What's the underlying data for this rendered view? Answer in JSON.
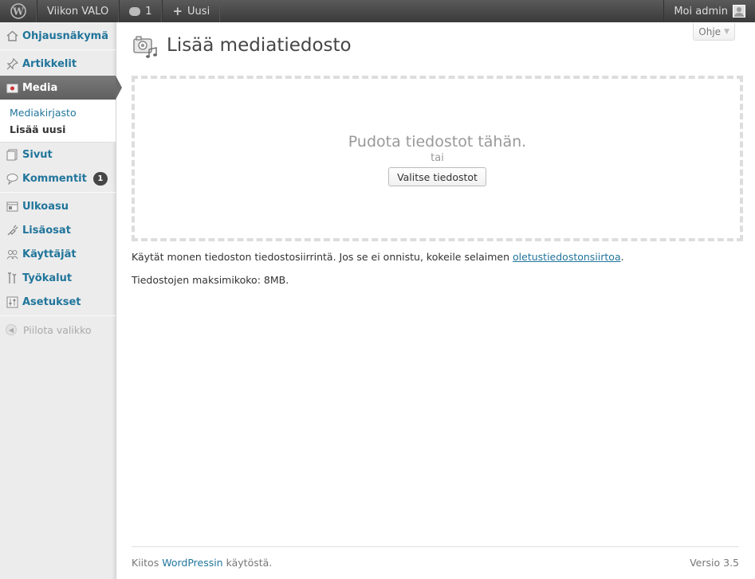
{
  "adminbar": {
    "logo_icon": "wordpress-logo-icon",
    "site_name": "Viikon VALO",
    "comments_count": "1",
    "new_label": "Uusi",
    "greeting": "Moi admin"
  },
  "sidebar": {
    "items": [
      {
        "label": "Ohjausnäkymä",
        "icon": "dashboard-icon"
      },
      {
        "label": "Artikkelit",
        "icon": "pin-icon"
      },
      {
        "label": "Media",
        "icon": "media-icon"
      },
      {
        "label": "Sivut",
        "icon": "pages-icon"
      },
      {
        "label": "Kommentit",
        "icon": "comments-icon",
        "badge": "1"
      },
      {
        "label": "Ulkoasu",
        "icon": "appearance-icon"
      },
      {
        "label": "Lisäosat",
        "icon": "plugins-icon"
      },
      {
        "label": "Käyttäjät",
        "icon": "users-icon"
      },
      {
        "label": "Työkalut",
        "icon": "tools-icon"
      },
      {
        "label": "Asetukset",
        "icon": "settings-icon"
      }
    ],
    "media_submenu": [
      {
        "label": "Mediakirjasto"
      },
      {
        "label": "Lisää uusi"
      }
    ],
    "collapse_label": "Piilota valikko"
  },
  "help": {
    "label": "Ohje"
  },
  "page": {
    "title": "Lisää mediatiedosto",
    "drop_text": "Pudota tiedostot tähän.",
    "or_text": "tai",
    "select_button": "Valitse tiedostot",
    "uploader_info_prefix": "Käytät monen tiedoston tiedostosiirrintä. Jos se ei onnistu, kokeile selaimen ",
    "uploader_info_link": "oletustiedostonsiirtoa",
    "uploader_info_suffix": ".",
    "max_size": "Tiedostojen maksimikoko: 8MB."
  },
  "footer": {
    "thanks_prefix": "Kiitos ",
    "thanks_link": "WordPressin",
    "thanks_suffix": " käytöstä.",
    "version": "Versio 3.5"
  },
  "colors": {
    "adminbar_bg": "#464646",
    "link": "#21759b",
    "sidebar_bg": "#ececec",
    "current_menu_bg": "#6a6a6a"
  }
}
